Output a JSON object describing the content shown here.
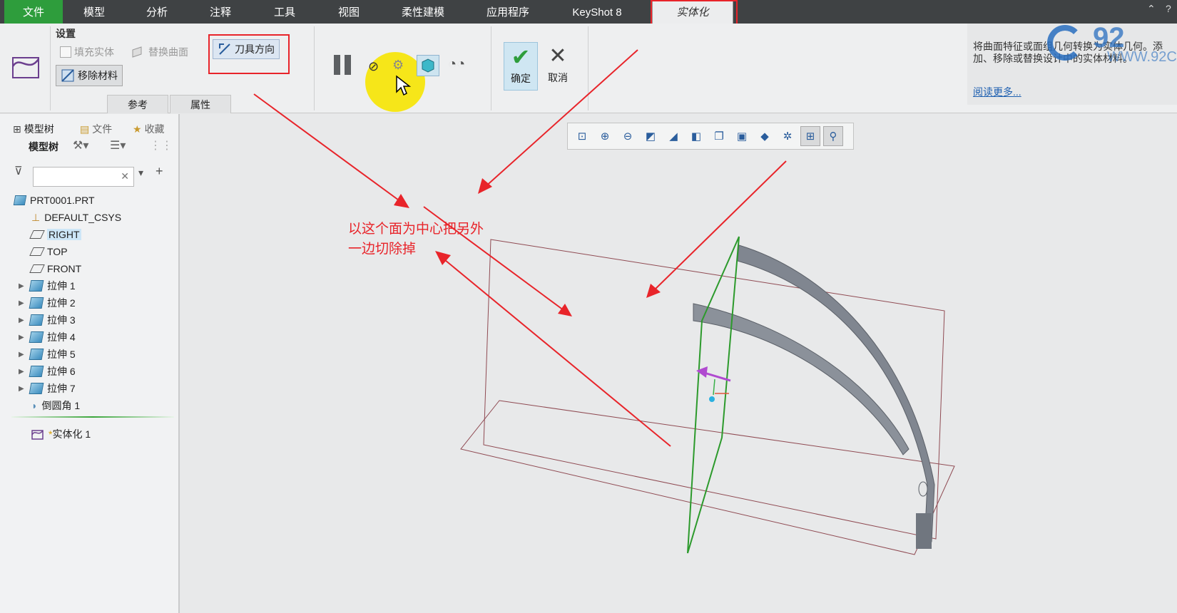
{
  "tabs": [
    "文件",
    "模型",
    "分析",
    "注释",
    "工具",
    "视图",
    "柔性建模",
    "应用程序",
    "KeyShot 8",
    "实体化"
  ],
  "ribbon": {
    "settings_label": "设置",
    "fill_solid": "填充实体",
    "replace_surface": "替换曲面",
    "tool_direction": "刀具方向",
    "remove_material": "移除材料",
    "ref_tab": "参考",
    "props_tab": "属性",
    "ok": "确定",
    "cancel": "取消"
  },
  "info": {
    "text": "将曲面特征或面组几何转换为实体几何。添加、移除或替换设计中的实体材料。",
    "link": "阅读更多...",
    "watermark_url": "WWW.92C",
    "watermark_logo": "92"
  },
  "left_panel": {
    "tab_model_tree": "模型树",
    "tab_folder": "文件",
    "tab_favorites": "收藏",
    "header": "模型树",
    "search_placeholder": "",
    "items": [
      {
        "label": "PRT0001.PRT",
        "icon": "part-icon"
      },
      {
        "label": "DEFAULT_CSYS",
        "icon": "csys-icon"
      },
      {
        "label": "RIGHT",
        "icon": "plane-icon"
      },
      {
        "label": "TOP",
        "icon": "plane-icon"
      },
      {
        "label": "FRONT",
        "icon": "plane-icon"
      },
      {
        "label": "拉伸 1",
        "icon": "extrude-icon"
      },
      {
        "label": "拉伸 2",
        "icon": "extrude-icon"
      },
      {
        "label": "拉伸 3",
        "icon": "extrude-icon"
      },
      {
        "label": "拉伸 4",
        "icon": "extrude-icon"
      },
      {
        "label": "拉伸 5",
        "icon": "extrude-icon"
      },
      {
        "label": "拉伸 6",
        "icon": "extrude-icon"
      },
      {
        "label": "拉伸 7",
        "icon": "extrude-icon"
      },
      {
        "label": "倒圆角 1",
        "icon": "round-icon"
      },
      {
        "label": "实体化 1",
        "icon": "solidify-icon"
      }
    ]
  },
  "callout": {
    "line1": "以这个面为中心把另外",
    "line2": "一边切除掉"
  },
  "colors": {
    "accent_green": "#2e9d3c",
    "annotation_red": "#e8242a",
    "tabbar": "#3f4244",
    "part_gray": "#7f8590",
    "plane_green": "#2c9a2c"
  }
}
